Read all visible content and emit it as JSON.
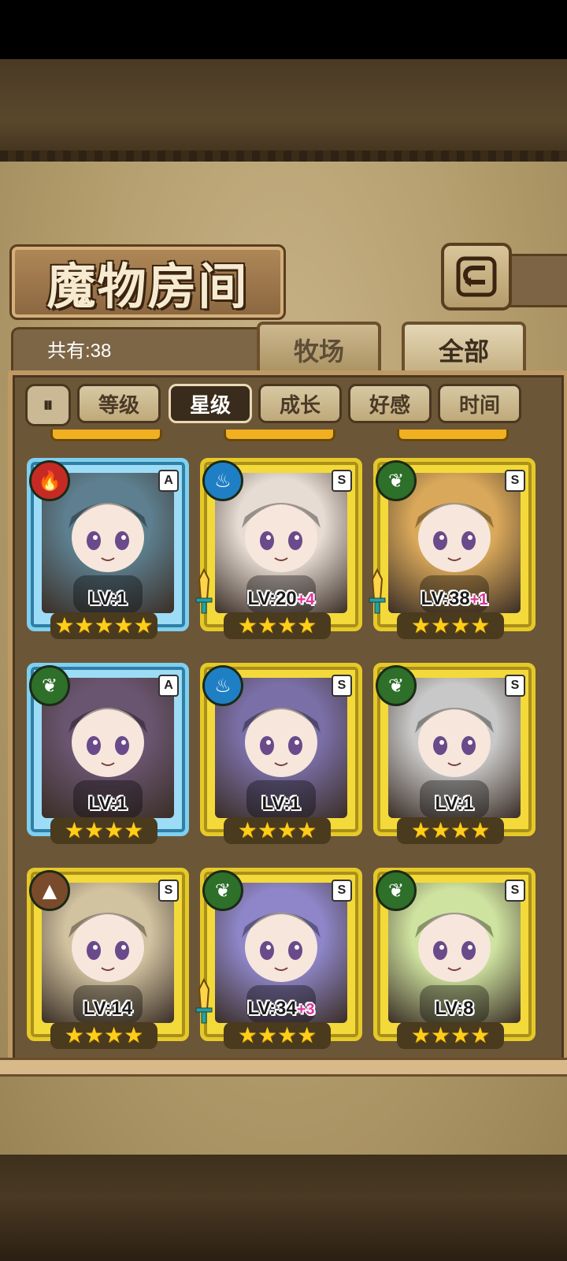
{
  "header": {
    "title": "魔物房间",
    "back_icon": "return-icon"
  },
  "count": {
    "label": "共有:38"
  },
  "tabs": [
    {
      "label": "牧场",
      "active": false
    },
    {
      "label": "全部",
      "active": true
    }
  ],
  "sort": {
    "toggle_label": "⏸",
    "options": [
      {
        "label": "等级",
        "active": false
      },
      {
        "label": "星级",
        "active": true
      },
      {
        "label": "成长",
        "active": false
      },
      {
        "label": "好感",
        "active": false
      },
      {
        "label": "时间",
        "active": false
      }
    ]
  },
  "cards": [
    {
      "element": "fire",
      "rank": "A",
      "level": "LV:1",
      "plus": "",
      "stars": 5,
      "weapon": false,
      "color": "#5d7f8f"
    },
    {
      "element": "water",
      "rank": "S",
      "level": "LV:20",
      "plus": "+4",
      "stars": 4,
      "weapon": true,
      "color": "#e7dcd3"
    },
    {
      "element": "wood",
      "rank": "S",
      "level": "LV:38",
      "plus": "+1",
      "stars": 4,
      "weapon": true,
      "color": "#d9a85a"
    },
    {
      "element": "wood",
      "rank": "A",
      "level": "LV:1",
      "plus": "",
      "stars": 4,
      "weapon": false,
      "color": "#6a5570"
    },
    {
      "element": "water",
      "rank": "S",
      "level": "LV:1",
      "plus": "",
      "stars": 4,
      "weapon": false,
      "color": "#7a6fa6"
    },
    {
      "element": "wood",
      "rank": "S",
      "level": "LV:1",
      "plus": "",
      "stars": 4,
      "weapon": false,
      "color": "#c8c8c8"
    },
    {
      "element": "earth",
      "rank": "S",
      "level": "LV:14",
      "plus": "",
      "stars": 4,
      "weapon": false,
      "color": "#d1c2a0"
    },
    {
      "element": "wood",
      "rank": "S",
      "level": "LV:34",
      "plus": "+3",
      "stars": 4,
      "weapon": true,
      "color": "#8e86c8"
    },
    {
      "element": "wood",
      "rank": "S",
      "level": "LV:8",
      "plus": "",
      "stars": 4,
      "weapon": false,
      "color": "#cfe3a0"
    }
  ]
}
